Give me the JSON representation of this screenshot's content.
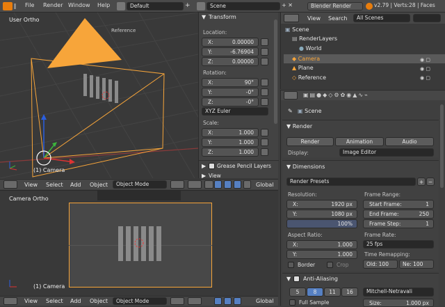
{
  "menubar": {
    "items": [
      "File",
      "Render",
      "Window",
      "Help"
    ],
    "layout": "Default",
    "scene": "Scene",
    "engine": "Blender Render",
    "stats": "v2.79 | Verts:28 | Faces"
  },
  "viewport_top": {
    "label": "User Ortho",
    "object_label": "(1) Camera",
    "reference_text": "Reference",
    "header": {
      "view": "View",
      "select": "Select",
      "add": "Add",
      "object": "Object",
      "mode": "Object Mode",
      "orientation": "Global"
    }
  },
  "viewport_bottom": {
    "label": "Camera Ortho",
    "object_label": "(1) Camera",
    "header": {
      "view": "View",
      "select": "Select",
      "add": "Add",
      "object": "Object",
      "mode": "Object Mode",
      "orientation": "Global"
    }
  },
  "transform": {
    "title": "Transform",
    "location_label": "Location:",
    "location": [
      {
        "axis": "X:",
        "value": "0.00000"
      },
      {
        "axis": "Y:",
        "value": "-6.76904"
      },
      {
        "axis": "Z:",
        "value": "0.00000"
      }
    ],
    "rotation_label": "Rotation:",
    "rotation": [
      {
        "axis": "X:",
        "value": "90°"
      },
      {
        "axis": "Y:",
        "value": "-0°"
      },
      {
        "axis": "Z:",
        "value": "-0°"
      }
    ],
    "rotation_mode": "XYZ Euler",
    "scale_label": "Scale:",
    "scale": [
      {
        "axis": "X:",
        "value": "1.000"
      },
      {
        "axis": "Y:",
        "value": "1.000"
      },
      {
        "axis": "Z:",
        "value": "1.000"
      }
    ],
    "grease_pencil": "Grease Pencil Layers",
    "view": "View"
  },
  "outliner": {
    "view": "View",
    "search": "Search",
    "filter": "All Scenes",
    "items": [
      "Scene",
      "RenderLayers",
      "World",
      "Camera",
      "Plane",
      "Reference"
    ]
  },
  "properties": {
    "breadcrumb": "Scene",
    "render": {
      "title": "Render",
      "buttons": [
        "Render",
        "Animation",
        "Audio"
      ],
      "display_label": "Display:",
      "display_value": "Image Editor"
    },
    "dimensions": {
      "title": "Dimensions",
      "presets": "Render Presets",
      "resolution_label": "Resolution:",
      "res_x": {
        "axis": "X:",
        "value": "1920 px"
      },
      "res_y": {
        "axis": "Y:",
        "value": "1080 px"
      },
      "percent": "100%",
      "frame_range_label": "Frame Range:",
      "start": {
        "label": "Start Frame:",
        "value": "1"
      },
      "end": {
        "label": "End Frame:",
        "value": "250"
      },
      "step": {
        "label": "Frame Step:",
        "value": "1"
      },
      "aspect_label": "Aspect Ratio:",
      "asp_x": {
        "axis": "X:",
        "value": "1.000"
      },
      "asp_y": {
        "axis": "Y:",
        "value": "1.000"
      },
      "frame_rate_label": "Frame Rate:",
      "fps": "25 fps",
      "remap_label": "Time Remapping:",
      "old": "Old: 100",
      "new": "Ne: 100",
      "border": "Border",
      "crop": "Crop"
    },
    "anti_aliasing": {
      "title": "Anti-Aliasing",
      "samples": [
        "5",
        "8",
        "11",
        "16"
      ],
      "filter": "Mitchell-Netravali",
      "full_sample": "Full Sample",
      "size": "Size:",
      "size_value": "1.000 px"
    }
  }
}
